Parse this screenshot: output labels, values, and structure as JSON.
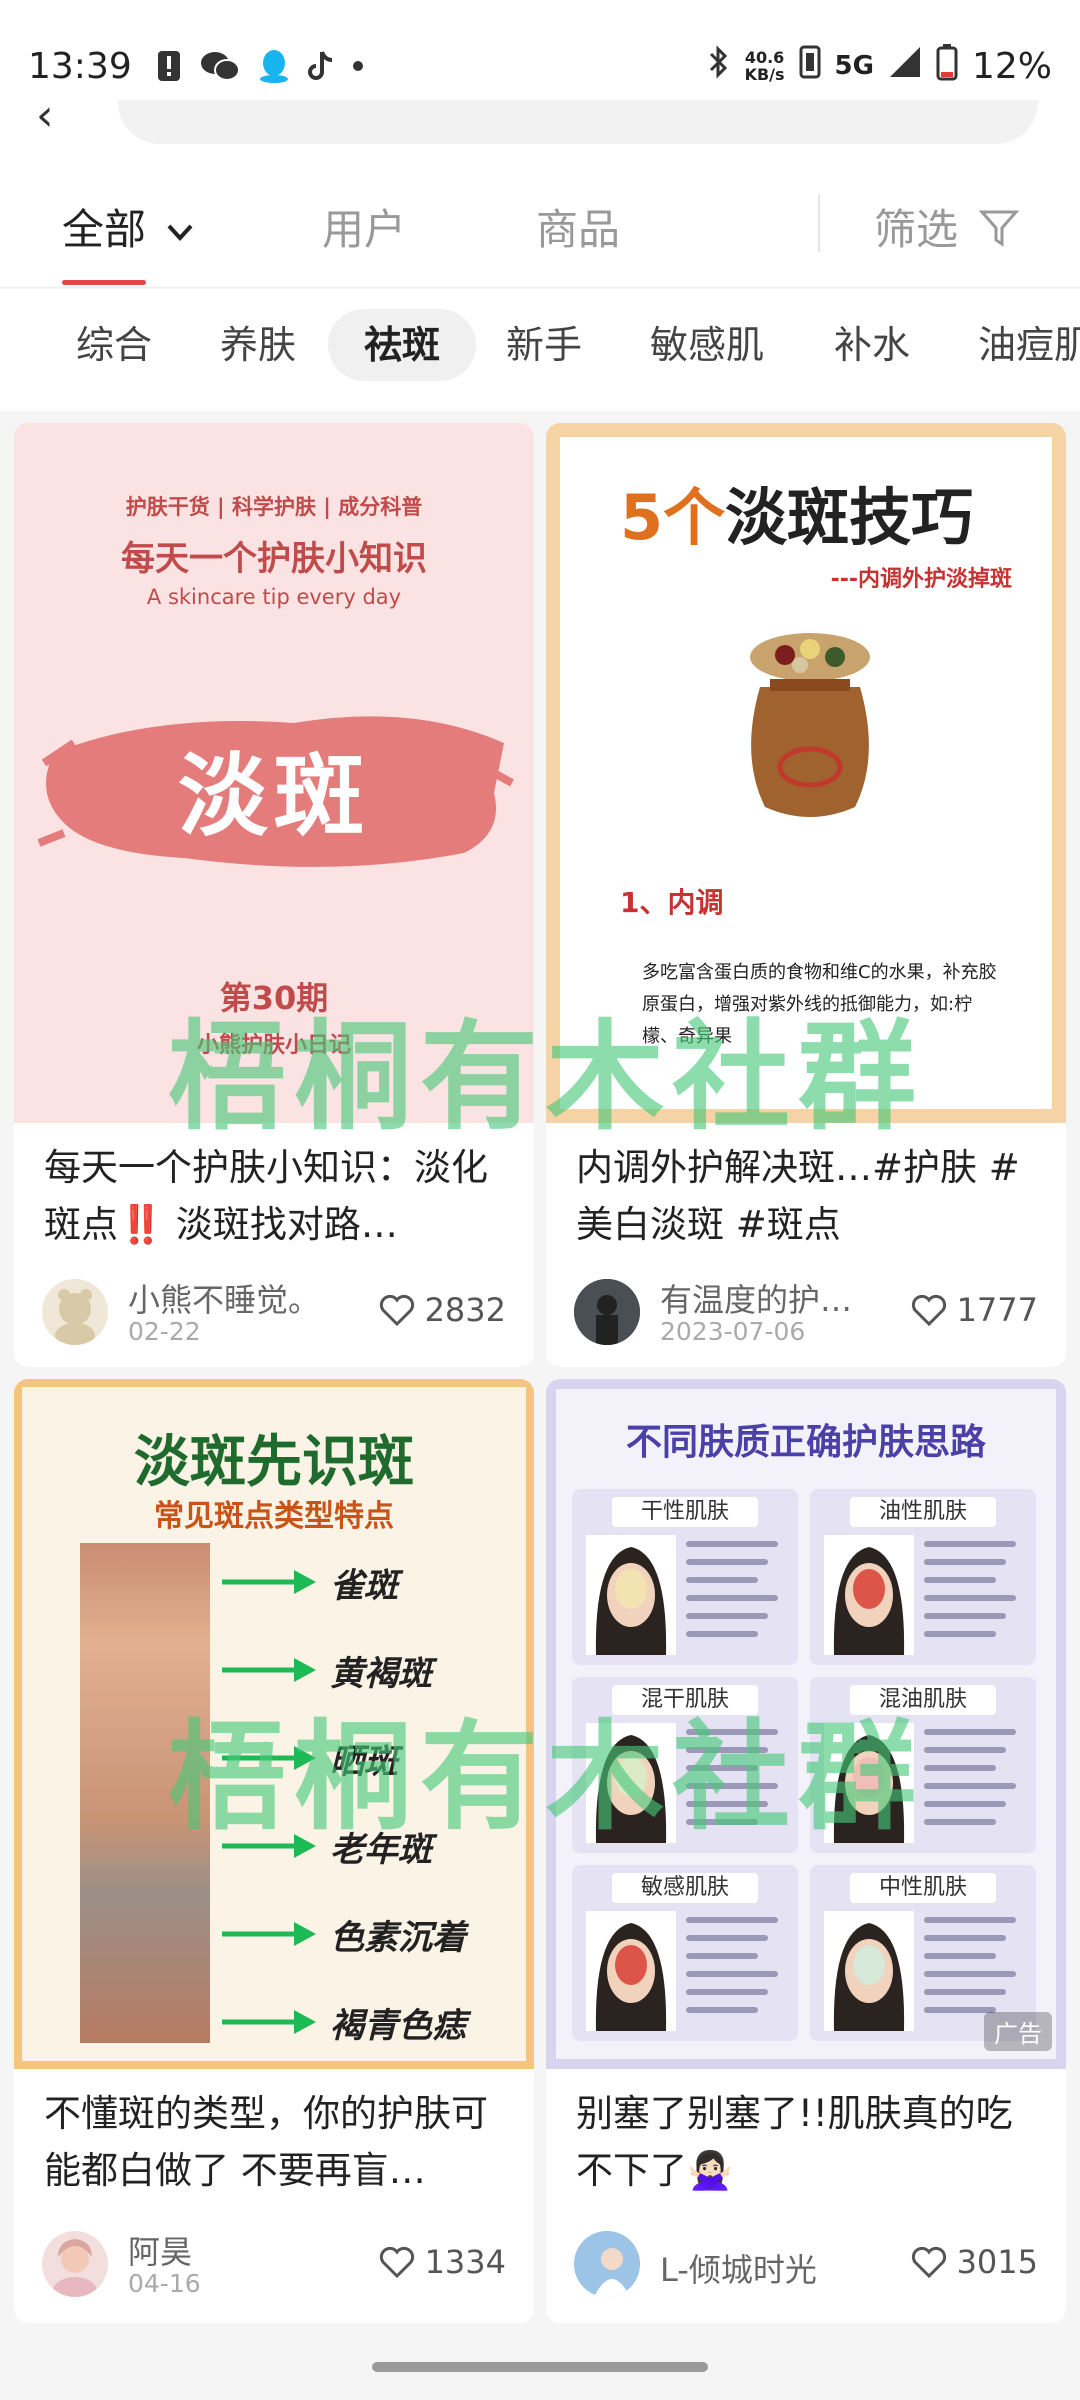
{
  "status_bar": {
    "time": "13:39",
    "net_speed": "40.6",
    "net_unit": "KB/s",
    "signal": "5G",
    "battery": "12%"
  },
  "tabs": {
    "all": "全部",
    "users": "用户",
    "products": "商品",
    "filter": "筛选"
  },
  "chips": [
    "综合",
    "养肤",
    "祛斑",
    "新手",
    "敏感肌",
    "补水",
    "油痘肌"
  ],
  "active_chip": "祛斑",
  "watermark": "梧桐有木社群",
  "cards": [
    {
      "cover": {
        "tagline": "护肤干货 | 科学护肤 | 成分科普",
        "headline": "每天一个护肤小知识",
        "subline": "A skincare tip every day",
        "big": "淡斑",
        "issue": "第30期",
        "series": "小熊护肤小日记"
      },
      "title": "每天一个护肤小知识：淡化斑点‼️ 淡斑找对路…",
      "author": "小熊不睡觉。",
      "date": "02-22",
      "likes": "2832"
    },
    {
      "cover": {
        "num": "5个",
        "headline": "淡斑技巧",
        "subline": "---内调外护淡掉斑",
        "section": "1、内调",
        "body": "多吃富含蛋白质的食物和维C的水果，补充胶原蛋白，增强对紫外线的抵御能力，如:柠檬、奇异果"
      },
      "title": "内调外护解决斑…#护肤 #美白淡斑 #斑点",
      "author": "有温度的护…",
      "date": "2023-07-06",
      "likes": "1777"
    },
    {
      "cover": {
        "headline": "淡斑先识斑",
        "subline": "常见斑点类型特点",
        "types": [
          "雀斑",
          "黄褐斑",
          "晒斑",
          "老年斑",
          "色素沉着",
          "褐青色痣"
        ]
      },
      "title": "不懂斑的类型，你的护肤可能都白做了 不要再盲…",
      "author": "阿昊",
      "date": "04-16",
      "likes": "1334"
    },
    {
      "cover": {
        "headline": "不同肤质正确护肤思路",
        "types": [
          "干性肌肤",
          "油性肌肤",
          "混干肌肤",
          "混油肌肤",
          "敏感肌肤",
          "中性肌肤"
        ],
        "ad": "广告"
      },
      "title": "别塞了别塞了!!肌肤真的吃不下了🙅🏻‍♀️",
      "author": "L-倾城时光",
      "date": "",
      "likes": "3015"
    }
  ]
}
